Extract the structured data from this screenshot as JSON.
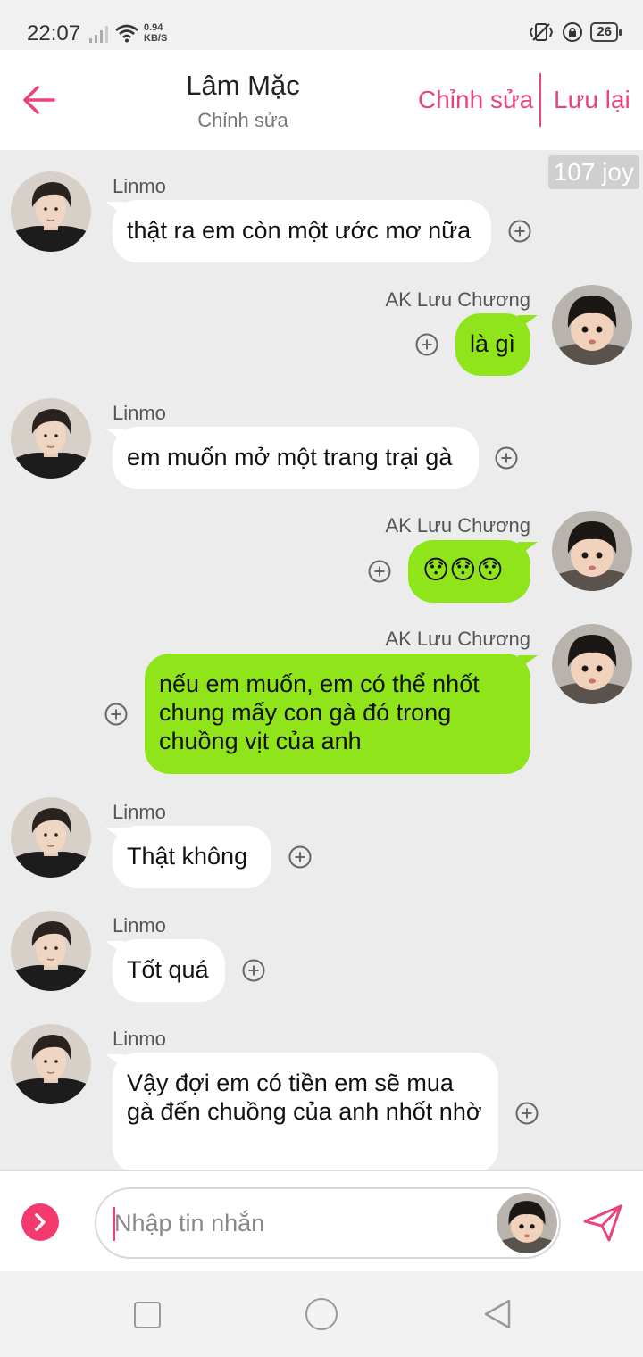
{
  "status": {
    "time": "22:07",
    "speed_value": "0.94",
    "speed_unit": "KB/S",
    "battery": "26"
  },
  "header": {
    "title": "Lâm Mặc",
    "subtitle": "Chỉnh sửa",
    "edit_label": "Chỉnh sửa",
    "save_label": "Lưu lại"
  },
  "badge": "107 joy",
  "messages": [
    {
      "sender": "Linmo",
      "side": "left",
      "text": "thật ra em còn một ước mơ nữa"
    },
    {
      "sender": "AK Lưu Chương",
      "side": "right",
      "text": "là gì"
    },
    {
      "sender": "Linmo",
      "side": "left",
      "text": "em muốn mở một trang trại gà"
    },
    {
      "sender": "AK Lưu Chương",
      "side": "right",
      "text": "😯😯😯"
    },
    {
      "sender": "AK Lưu Chương",
      "side": "right",
      "text": "nếu em muốn, em có thể nhốt chung mấy con gà đó trong chuồng vịt của anh"
    },
    {
      "sender": "Linmo",
      "side": "left",
      "text": "Thật không"
    },
    {
      "sender": "Linmo",
      "side": "left",
      "text": "Tốt quá"
    },
    {
      "sender": "Linmo",
      "side": "left",
      "text": "Vậy đợi em có tiền em sẽ mua gà đến chuồng của anh nhốt nhờ"
    }
  ],
  "input": {
    "placeholder": "Nhập tin nhắn"
  },
  "colors": {
    "accent": "#e8447e",
    "own_bubble": "#90e41a",
    "other_bubble": "#ffffff"
  },
  "icons": [
    "back-arrow-icon",
    "add-circle-icon",
    "send-icon",
    "chevron-right-icon",
    "signal-icon",
    "wifi-icon",
    "vibrate-icon",
    "rotation-lock-icon"
  ]
}
